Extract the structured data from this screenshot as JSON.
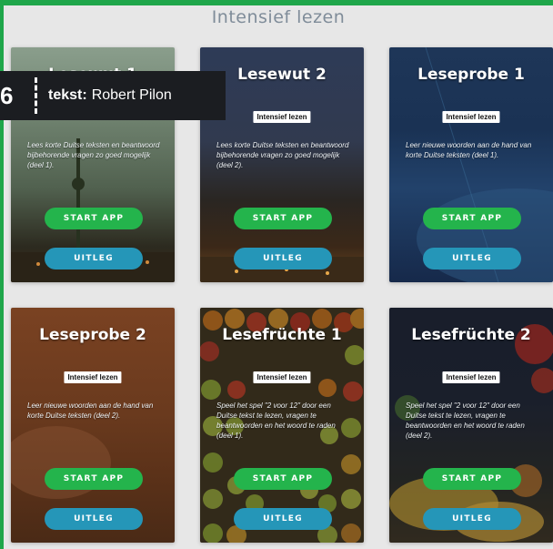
{
  "page": {
    "title": "Intensief lezen"
  },
  "credit": {
    "number": "6",
    "label": "tekst:",
    "author": "Robert Pilon"
  },
  "cards": [
    {
      "title": "Lesewut 1",
      "badge": "",
      "description": "Lees korte Duitse teksten en beantwoord bijbehorende vragen zo goed mogelijk (deel 1).",
      "start": "START APP",
      "info": "UITLEG"
    },
    {
      "title": "Lesewut 2",
      "badge": "Intensief lezen",
      "description": "Lees korte Duitse teksten en beantwoord bijbehorende vragen zo goed mogelijk (deel 2).",
      "start": "START APP",
      "info": "UITLEG"
    },
    {
      "title": "Leseprobe 1",
      "badge": "Intensief lezen",
      "description": "Leer nieuwe woorden aan de hand van korte Duitse teksten (deel 1).",
      "start": "START APP",
      "info": "UITLEG"
    },
    {
      "title": "Leseprobe 2",
      "badge": "Intensief lezen",
      "description": "Leer nieuwe woorden aan de hand van korte Duitse teksten (deel 2).",
      "start": "START APP",
      "info": "UITLEG"
    },
    {
      "title": "Lesefrüchte 1",
      "badge": "Intensief lezen",
      "description": "Speel het spel \"2 voor 12\" door een Duitse tekst te lezen, vragen te beantwoorden en het woord te raden (deel 1).",
      "start": "START APP",
      "info": "UITLEG"
    },
    {
      "title": "Lesefrüchte 2",
      "badge": "Intensief lezen",
      "description": "Speel het spel \"2 voor 12\" door een Duitse tekst te lezen, vragen te beantwoorden en het woord te raden (deel 2).",
      "start": "START APP",
      "info": "UITLEG"
    }
  ]
}
